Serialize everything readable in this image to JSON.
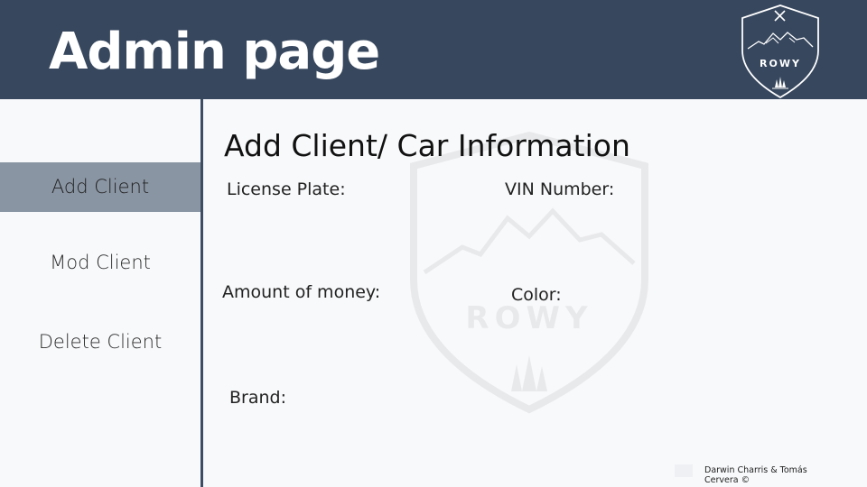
{
  "header": {
    "title": "Admin page",
    "logo_text": "ROWY"
  },
  "sidebar": {
    "items": [
      {
        "label": "Add Client",
        "active": true
      },
      {
        "label": "Mod Client",
        "active": false
      },
      {
        "label": "Delete Client",
        "active": false
      }
    ]
  },
  "main": {
    "section_title": "Add Client/ Car Information",
    "fields": {
      "license_plate": "License Plate:",
      "vin_number": "VIN Number:",
      "amount_of_money": "Amount of money:",
      "color": "Color:",
      "brand": "Brand:"
    },
    "watermark_text": "ROWY"
  },
  "footer": {
    "credit": "Darwin Charris & Tomás Cervera ©"
  },
  "colors": {
    "header_bg": "#37475e",
    "active_item_bg": "#8a95a3",
    "page_bg": "#f8f9fb"
  },
  "icons": {
    "logo": "mountain-shield-icon",
    "watermark": "mountain-shield-icon"
  }
}
